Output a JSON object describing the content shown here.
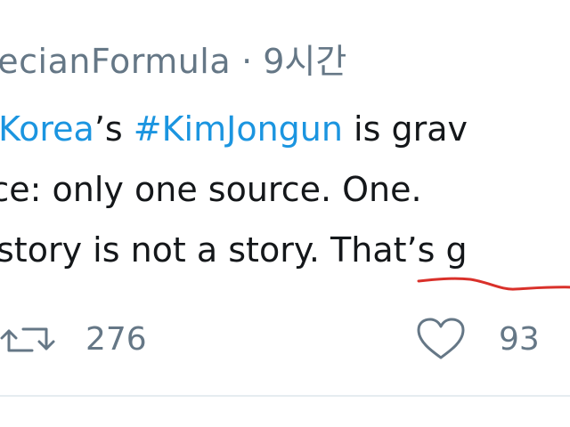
{
  "tweet": {
    "handle": "recianFormula",
    "separator": "·",
    "time": "9시간",
    "line1": {
      "hashtag1": "nKorea",
      "text1": "’s ",
      "hashtag2": "#KimJongun",
      "text2": " is grav"
    },
    "line2": "ece: only one source. One.",
    "line3": {
      "text": "story is not a story. ",
      "emphasis": "That’s g"
    }
  },
  "actions": {
    "retweet_icon": "retweet-icon",
    "retweet_count": "276",
    "like_icon": "heart-icon",
    "like_count": "93"
  },
  "colors": {
    "hashtag": "#1b95e0",
    "meta": "#657786",
    "text": "#14171a",
    "underline_annotation": "#d9302a"
  }
}
